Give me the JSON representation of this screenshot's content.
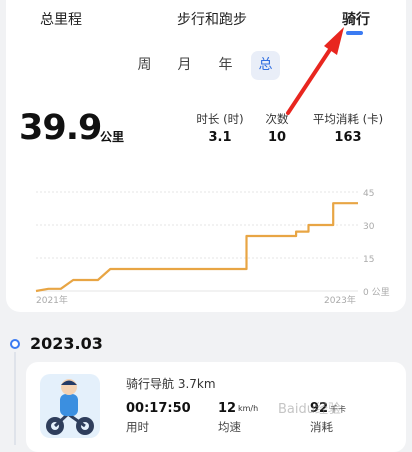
{
  "tabs": [
    {
      "label": "总里程"
    },
    {
      "label": "步行和跑步"
    },
    {
      "label": "骑行"
    }
  ],
  "period": [
    "周",
    "月",
    "年",
    "总"
  ],
  "summary": {
    "distance": "39.9",
    "unit": "公里",
    "stats": [
      {
        "label": "时长 (时)",
        "value": "3.1"
      },
      {
        "label": "次数",
        "value": "10"
      },
      {
        "label": "平均消耗 (卡)",
        "value": "163"
      }
    ]
  },
  "chart_data": {
    "type": "line",
    "x": [
      "2021-01",
      "2021-02",
      "2021-03",
      "2021-04",
      "2021-05",
      "2021-06",
      "2021-07",
      "2021-08",
      "2022-06",
      "2022-06",
      "2022-07",
      "2022-07",
      "2022-10",
      "2022-10",
      "2022-11",
      "2022-11",
      "2023-01",
      "2023-01",
      "2023-03"
    ],
    "y": [
      0,
      1,
      1,
      5,
      5,
      5,
      10,
      10,
      10,
      25,
      25,
      25,
      25,
      27,
      27,
      30,
      30,
      39.9,
      39.9
    ],
    "ylim": [
      0,
      45
    ],
    "yticks": [
      "0 公里",
      "15",
      "30",
      "45"
    ],
    "xlabels": [
      "2021年",
      "2023年"
    ],
    "color": "#e8a544",
    "grid": true
  },
  "history": {
    "month": "2023.03",
    "records": [
      {
        "title": "骑行导航 3.7km",
        "duration": "00:17:50",
        "duration_label": "用时",
        "speed": "12",
        "speed_unit": "km/h",
        "speed_label": "均速",
        "calories": "92",
        "calories_unit": "千卡",
        "calories_label": "消耗"
      }
    ]
  },
  "watermark": "Baidu经验",
  "colors": {
    "accent": "#3b7bf2",
    "line": "#e8a544",
    "arrow": "#e8261f"
  }
}
